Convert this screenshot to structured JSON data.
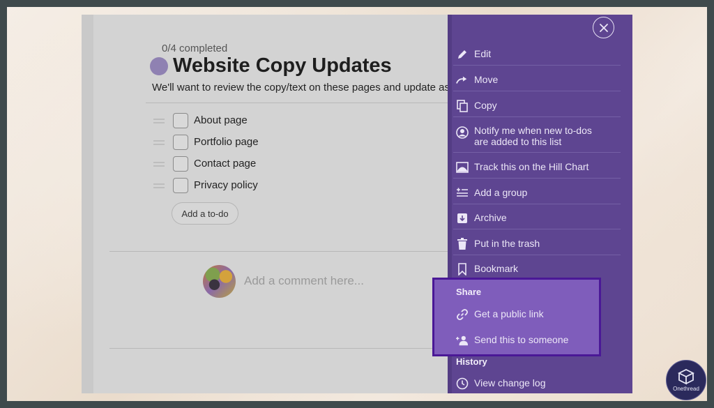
{
  "todo_list": {
    "progress": "0/4 completed",
    "title": "Website Copy Updates",
    "description": "We'll want to review the copy/text on these pages and update as",
    "items": [
      {
        "label": "About page",
        "checked": false
      },
      {
        "label": "Portfolio page",
        "checked": false
      },
      {
        "label": "Contact page",
        "checked": false
      },
      {
        "label": "Privacy policy",
        "checked": false
      }
    ],
    "add_todo_label": "Add a to-do",
    "comment_placeholder": "Add a comment here..."
  },
  "menu": {
    "items": [
      {
        "label": "Edit",
        "icon": "pencil-icon"
      },
      {
        "label": "Move",
        "icon": "move-arrow-icon"
      },
      {
        "label": "Copy",
        "icon": "copy-icon"
      },
      {
        "label": "Notify me when new to-dos are added to this list",
        "icon": "person-circle-icon"
      },
      {
        "label": "Track this on the Hill Chart",
        "icon": "hill-chart-icon"
      },
      {
        "label": "Add a group",
        "icon": "add-group-icon"
      },
      {
        "label": "Archive",
        "icon": "archive-icon"
      },
      {
        "label": "Put in the trash",
        "icon": "trash-icon"
      },
      {
        "label": "Bookmark",
        "icon": "bookmark-icon"
      }
    ],
    "share_heading": "Share",
    "share_items": [
      {
        "label": "Get a public link",
        "icon": "link-icon"
      },
      {
        "label": "Send this to someone",
        "icon": "add-person-icon"
      }
    ],
    "history_heading": "History",
    "history_items": [
      {
        "label": "View change log",
        "icon": "clock-icon"
      }
    ]
  },
  "watermark": {
    "name": "Onethread"
  },
  "colors": {
    "menu_background": "#5e4591",
    "share_highlight": "#7f5dbb",
    "share_border": "#4a1896",
    "status_dot": "#8f81b2"
  }
}
